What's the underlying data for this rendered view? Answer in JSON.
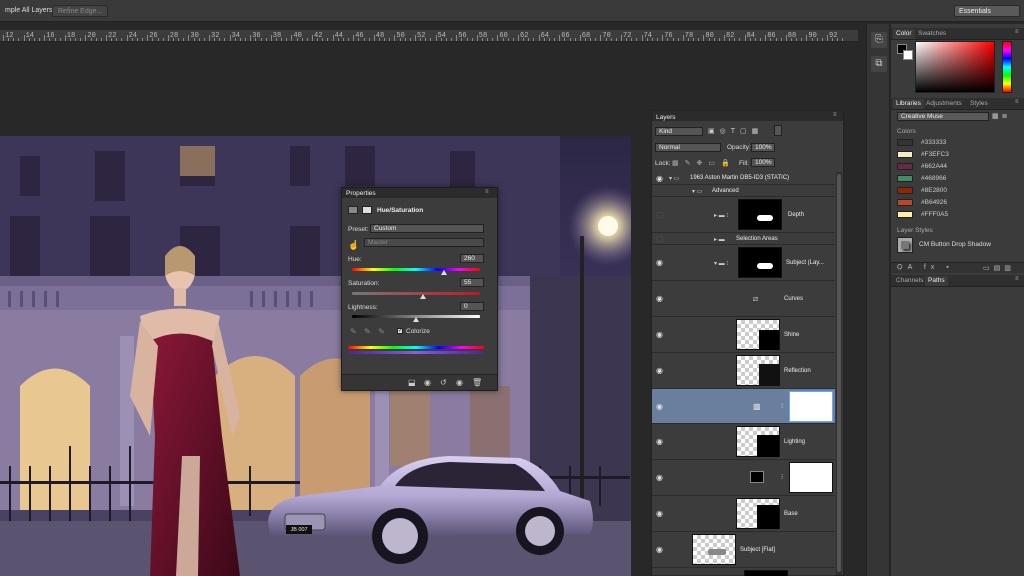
{
  "options_bar": {
    "sample_all_layers": "mple All Layers",
    "refine_edge": "Refine Edge...",
    "workspace": "Essentials"
  },
  "ruler": {
    "marks": [
      "12",
      "14",
      "16",
      "18",
      "20",
      "22",
      "24",
      "26",
      "28",
      "30",
      "32",
      "34",
      "36",
      "38",
      "40",
      "42",
      "44",
      "46",
      "48",
      "50",
      "52",
      "54",
      "56",
      "58",
      "60",
      "62",
      "64",
      "66",
      "68",
      "70",
      "72",
      "74",
      "76",
      "78",
      "80",
      "82",
      "84",
      "86",
      "88",
      "90",
      "92"
    ]
  },
  "properties": {
    "title": "Properties",
    "adjustment_name": "Hue/Saturation",
    "preset_label": "Preset:",
    "preset_value": "Custom",
    "channel_value": "Master",
    "hue_label": "Hue:",
    "hue_value": "260",
    "saturation_label": "Saturation:",
    "saturation_value": "55",
    "lightness_label": "Lightness:",
    "lightness_value": "0",
    "colorize_label": "Colorize"
  },
  "layers": {
    "title": "Layers",
    "filter_kind": "Kind",
    "blend_mode": "Normal",
    "opacity_label": "Opacity:",
    "opacity_value": "100%",
    "lock_label": "Lock:",
    "fill_label": "Fill:",
    "fill_value": "100%",
    "rows": [
      {
        "name": "1963 Aston Martin DB5-ID3 (STATIC)"
      },
      {
        "name": "Advanced"
      },
      {
        "name": "Depth"
      },
      {
        "name": "Selection Areas"
      },
      {
        "name": "Subject (Lay..."
      },
      {
        "name": "Curves"
      },
      {
        "name": "Shine"
      },
      {
        "name": "Reflection"
      },
      {
        "name": ""
      },
      {
        "name": "Lighting"
      },
      {
        "name": ""
      },
      {
        "name": "Base"
      },
      {
        "name": "Subject [Flat]"
      }
    ]
  },
  "dock": {
    "color_tabs": [
      "Color",
      "Swatches"
    ],
    "lib_tabs": [
      "Libraries",
      "Adjustments",
      "Styles"
    ],
    "library_name": "Creative Muse",
    "colors_heading": "Colors",
    "swatches": [
      {
        "hex": "#333333",
        "label": "#333333"
      },
      {
        "hex": "#F3EFC3",
        "label": "#F3EFC3"
      },
      {
        "hex": "#662A44",
        "label": "#662A44"
      },
      {
        "hex": "#468966",
        "label": "#468966"
      },
      {
        "hex": "#8E2800",
        "label": "#8E2800"
      },
      {
        "hex": "#B64926",
        "label": "#B64926"
      },
      {
        "hex": "#FFF0A5",
        "label": "#FFF0A5"
      }
    ],
    "layer_styles_heading": "Layer Styles",
    "layer_style_item": "CM Button Drop Shadow",
    "bottom_tabs": [
      "Channels",
      "Paths"
    ]
  },
  "photo": {
    "license_plate": "JB 007"
  }
}
